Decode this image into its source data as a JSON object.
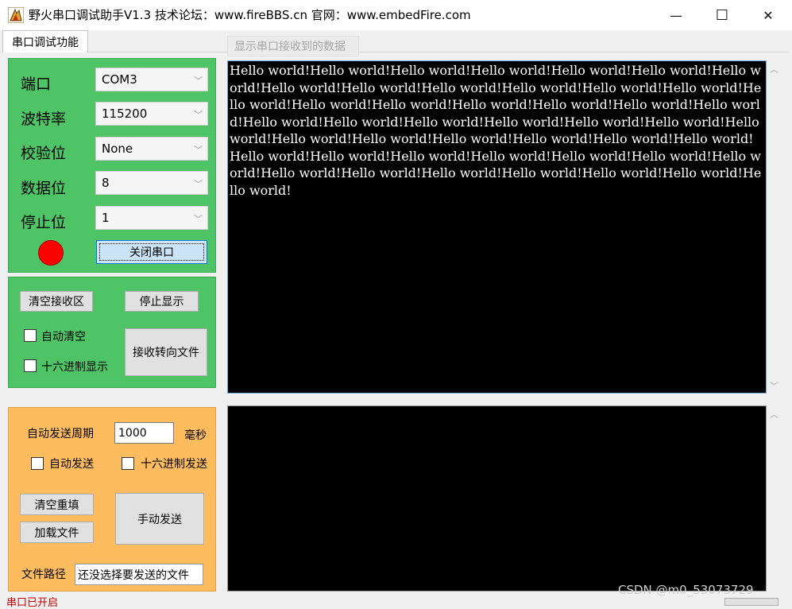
{
  "window": {
    "title": "野火串口调试助手V1.3    技术论坛：www.fireBBS.cn   官网：www.embedFire.com",
    "min_glyph": "—",
    "max_glyph": "☐",
    "close_glyph": "✕"
  },
  "tab": {
    "label": "串口调试功能"
  },
  "receive": {
    "group_label": "显示串口接收到的数据",
    "text": "Hello world!Hello world!Hello world!Hello world!Hello world!Hello world!Hello world!Hello world!Hello world!Hello world!Hello world!Hello world!Hello world!Hello world!Hello world!Hello world!Hello world!Hello world!Hello world!Hello world!Hello world!Hello world!Hello world!Hello world!Hello world!Hello world!Hello world!Hello world!Hello world!Hello world!Hello world!Hello world!Hello world!Hello world!Hello world!Hello world!Hello world!Hello world!Hello world!Hello world!Hello world!Hello world!Hello world!Hello world!Hello world!Hello world!Hello world!"
  },
  "port": {
    "port_label": "端口",
    "port_value": "COM3",
    "baud_label": "波特率",
    "baud_value": "115200",
    "parity_label": "校验位",
    "parity_value": "None",
    "databits_label": "数据位",
    "databits_value": "8",
    "stopbits_label": "停止位",
    "stopbits_value": "1",
    "close_button": "关闭串口",
    "status_color": "#ff0000"
  },
  "recv_controls": {
    "clear_button": "清空接收区",
    "stop_button": "停止显示",
    "auto_clear_label": "自动清空",
    "hex_display_label": "十六进制显示",
    "redirect_button": "接收转向文件"
  },
  "send_controls": {
    "period_label": "自动发送周期",
    "period_value": "1000",
    "unit_label": "毫秒",
    "auto_send_label": "自动发送",
    "hex_send_label": "十六进制发送",
    "clear_button": "清空重填",
    "load_button": "加载文件",
    "manual_send_button": "手动发送",
    "file_path_label": "文件路径",
    "file_path_value": "还没选择要发送的文件"
  },
  "status": {
    "text": "串口已开启"
  },
  "watermark": "CSDN @m0_53073729",
  "colors": {
    "port_panel": "#4ec466",
    "send_panel": "#ffbc5e",
    "terminal": "#000000"
  }
}
